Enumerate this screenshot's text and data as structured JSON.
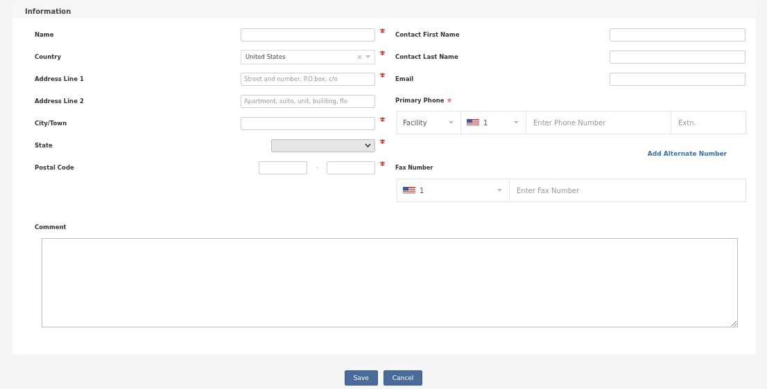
{
  "section_title": "Information",
  "left_fields": [
    {
      "label": "Name",
      "kind": "text",
      "required": true
    },
    {
      "label": "Country",
      "kind": "select",
      "value": "United States",
      "clearable": true,
      "required": true
    },
    {
      "label": "Address Line 1",
      "kind": "text",
      "placeholder": "Street and number, P.O.box, c/o",
      "required": true
    },
    {
      "label": "Address Line 2",
      "kind": "text",
      "placeholder": "Apartment, suite, unit, building, flo",
      "required": false
    },
    {
      "label": "City/Town",
      "kind": "text",
      "required": true
    },
    {
      "label": "State",
      "kind": "native-select",
      "disabled": true,
      "required": true
    },
    {
      "label": "Postal Code",
      "kind": "postal",
      "separator": "-",
      "required": true
    }
  ],
  "right_fields": [
    {
      "label": "Contact First Name"
    },
    {
      "label": "Contact Last Name"
    },
    {
      "label": "Email"
    }
  ],
  "primary_phone": {
    "label": "Primary Phone",
    "required": true,
    "type": "Facility",
    "country_code": "1",
    "placeholder": "Enter Phone Number",
    "ext_placeholder": "Extn."
  },
  "add_alternate": "Add Alternate Number",
  "fax": {
    "label": "Fax Number",
    "country_code": "1",
    "placeholder": "Enter Fax Number"
  },
  "comment": {
    "label": "Comment"
  },
  "buttons": [
    "Save",
    "Cancel"
  ]
}
